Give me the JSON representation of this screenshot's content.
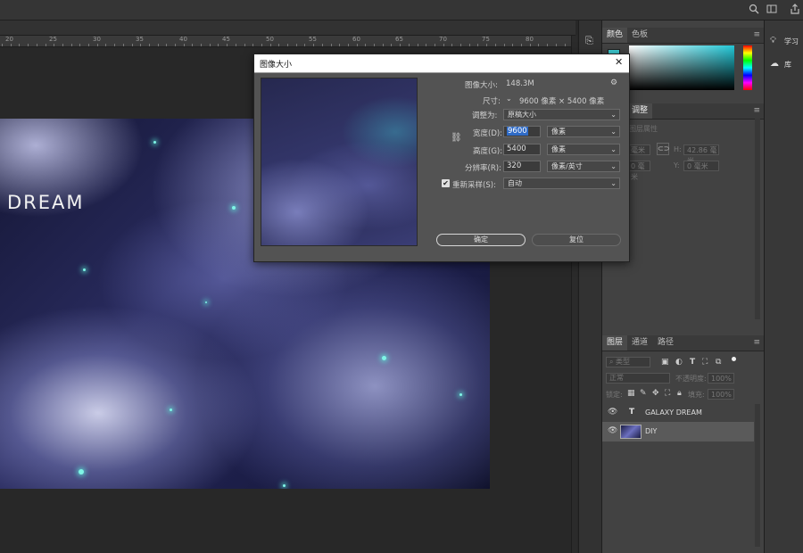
{
  "topbar": {
    "icons": [
      "search-icon",
      "workspace-icon",
      "share-icon"
    ]
  },
  "ruler": {
    "labels": [
      "20",
      "25",
      "30",
      "35",
      "40",
      "45",
      "50",
      "55",
      "60",
      "65",
      "70",
      "75",
      "80"
    ]
  },
  "canvas": {
    "title_text": "DREAM"
  },
  "dialog": {
    "title": "图像大小",
    "close_glyph": "✕",
    "image_size_label": "图像大小:",
    "image_size_value": "148.3M",
    "dimensions_label": "尺寸:",
    "dimensions_value": "9600 像素 × 5400 像素",
    "fit_to_label": "调整为:",
    "fit_to_value": "原稿大小",
    "width_label": "宽度(D):",
    "width_value": "9600",
    "width_unit": "像素",
    "height_label": "高度(G):",
    "height_value": "5400",
    "height_unit": "像素",
    "resolution_label": "分辨率(R):",
    "resolution_value": "320",
    "resolution_unit": "像素/英寸",
    "resample_label": "重新采样(S):",
    "resample_value": "自动",
    "ok_label": "确定",
    "reset_label": "复位"
  },
  "color_panel": {
    "tabs": [
      "颜色",
      "色板"
    ],
    "fg_color": "#3fd1d8"
  },
  "properties_panel": {
    "tabs": [
      "调整"
    ],
    "subtitle": "文本图层属性",
    "w_value": "毫米",
    "h_label": "H:",
    "h_value": "42.86 毫米",
    "x_value": "0 毫米",
    "y_label": "Y:",
    "y_value": "0 毫米"
  },
  "layers_panel": {
    "tabs": [
      "图层",
      "通道",
      "路径"
    ],
    "filter_kind": "类型",
    "blend_mode": "正常",
    "opacity_label": "不透明度:",
    "opacity_value": "100%",
    "lock_label": "锁定:",
    "fill_label": "填充:",
    "fill_value": "100%",
    "layers": [
      {
        "name": "GALAXY DREAM",
        "type_glyph": "T"
      },
      {
        "name": "DIY"
      }
    ]
  },
  "far_right": {
    "learn_label": "学习",
    "library_label": "库"
  }
}
